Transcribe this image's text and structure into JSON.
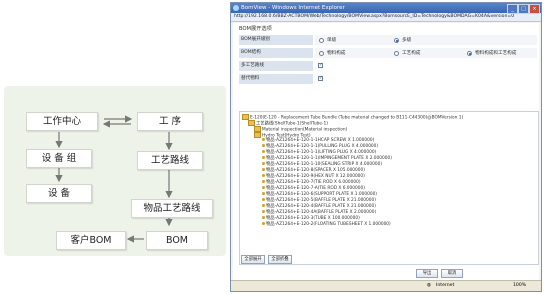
{
  "flowchart": {
    "nodes": {
      "work_center": "工作中心",
      "process": "工  序",
      "equipment_group": "设 备 组",
      "process_route": "工艺路线",
      "equipment": "设  备",
      "item_process_route": "物品工艺路线",
      "customer_bom": "客户BOM",
      "bom": "BOM"
    }
  },
  "browser": {
    "window_title": "BomView - Windows Internet Explorer",
    "address": "http://192.168.0.6/BBZ-ACTBOM/Web/Technology/BOMView.aspx?BomsourcE_ID=Technology&BOMDAG=K04A&version=0",
    "status_zone": "Internet",
    "zoom": "100%",
    "section_title": "BOM展开选项",
    "options": {
      "bom_expand_level": {
        "label": "BOM展开级别",
        "choices": [
          "单级",
          "多级"
        ],
        "selected": 1
      },
      "bom_structure": {
        "label": "BOM结构",
        "choices": [
          "物料构成",
          "工艺构成",
          "物料构成和工艺构成"
        ],
        "selected": 2
      },
      "multi_route": {
        "label": "多工艺路线",
        "checked": true
      },
      "substitute": {
        "label": "替代物料",
        "checked": true
      }
    },
    "tree": {
      "root": "E-120(E-120 - Replacement Tube Bundle (Tube material changed to B111-C44300)@BOMVersion 1)",
      "level1": "工艺路线(ShellTube-1(ShellTube-1)",
      "material": "Material inspection(Material inspection)",
      "process": "Hydro Test(Hydro Test)",
      "items": [
        "物品-AZ1264+E-120-1-1HCAP SCREW X 1.000000)",
        "物品-AZ1264+E-120-1-1(PULLING PLUG X 4.000000)",
        "物品-AZ1264+E-120-1-1(LIFTING PLUG X 4.000000)",
        "物品-AZ1264+E-120-1-1(IMPINGEMENT PLATE X 2.000000)",
        "物品-AZ1264+E-120-1-10(SEALING STRIP X 4.000000)",
        "物品-AZ1264+E-120-8(SPACER X 105.000000)",
        "物品-AZ1264+E-120-9(HEX NUT X 12.000000)",
        "物品-AZ1264+E-120-7(TIE ROD X 6.000000)",
        "物品-AZ1264+E-120-7-A(TIE ROD X 6.000000)",
        "物品-AZ1264+E-120-6(SUPPORT PLATE X 1.000000)",
        "物品-AZ1264+E-120-5(BAFFLE PLATE X 21.000000)",
        "物品-AZ1264+E-120-4(BAFFLE PLATE X 21.000000)",
        "物品-AZ1264+E-120-4A(BAFFLE PLATE X 2.000000)",
        "物品-AZ1264+E-120-3(TUBE X 100.000000)",
        "物品-AZ1264+E-120-2(FLOATING TUBESHEET X 1.000000)"
      ]
    },
    "buttons": {
      "expand": "全部展开",
      "collapse": "全部折叠",
      "export": "导出",
      "cancel": "取消"
    }
  }
}
